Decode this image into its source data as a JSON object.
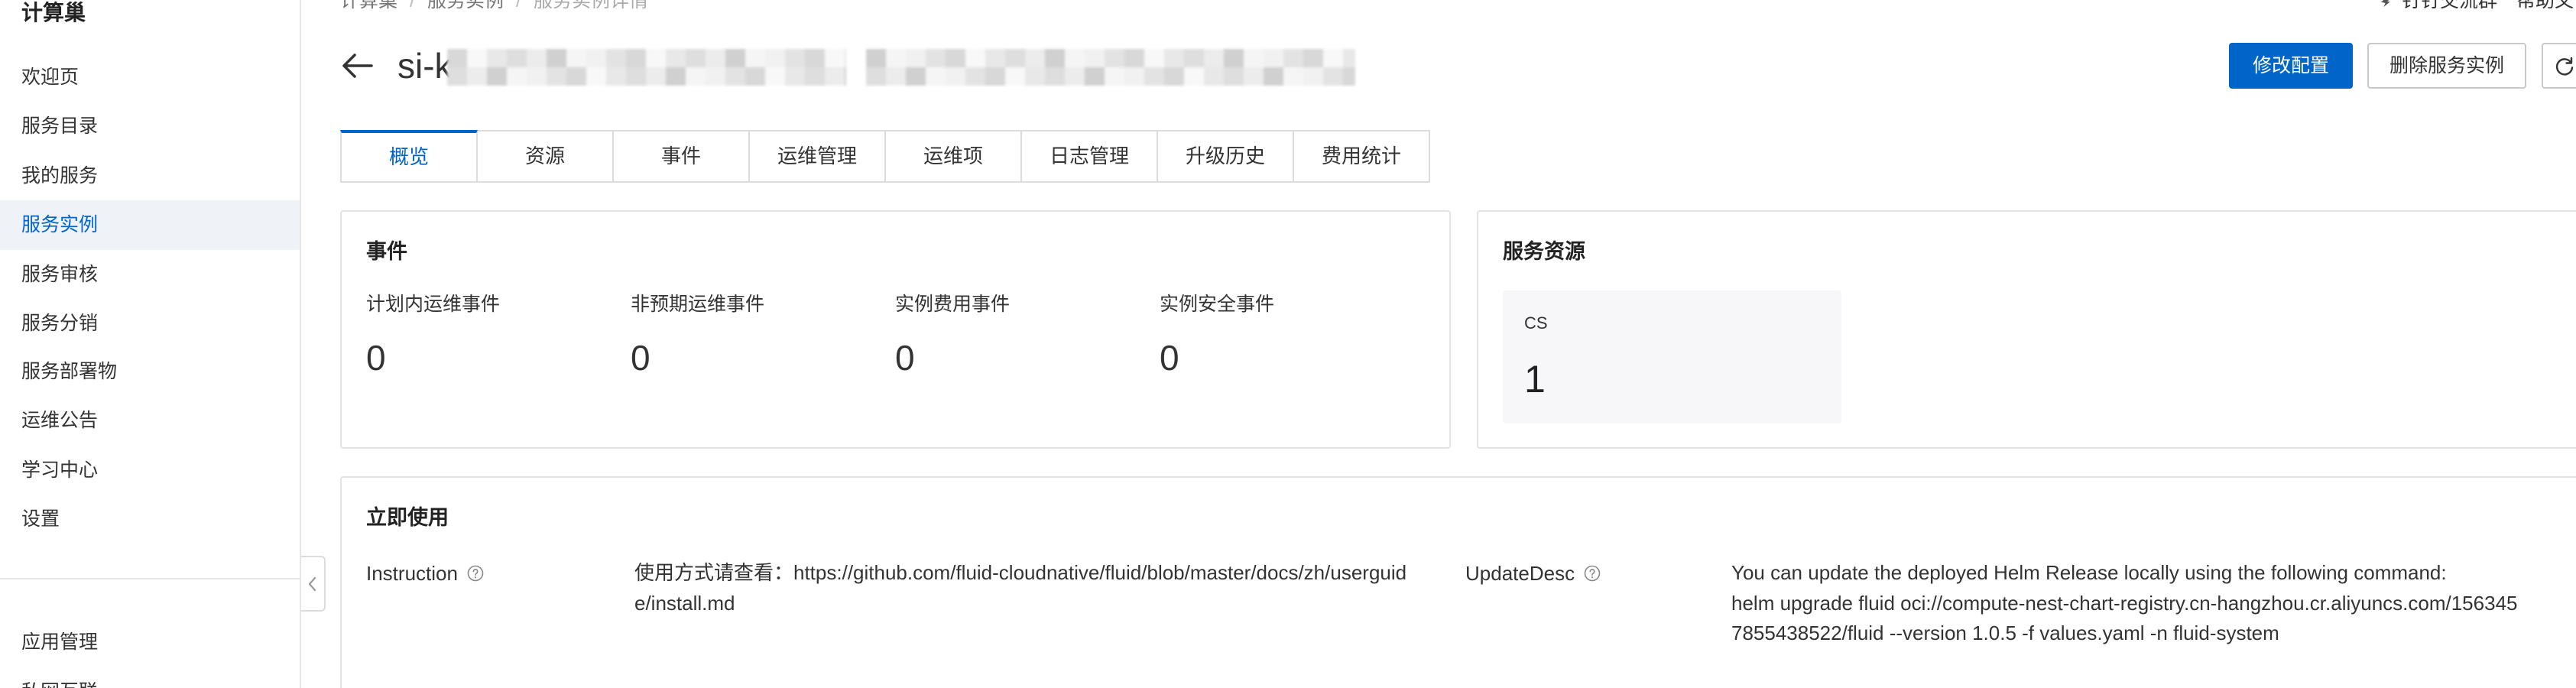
{
  "sidebar": {
    "title": "计算巢",
    "items": [
      {
        "label": "欢迎页"
      },
      {
        "label": "服务目录"
      },
      {
        "label": "我的服务"
      },
      {
        "label": "服务实例",
        "selected": true
      },
      {
        "label": "服务审核"
      },
      {
        "label": "服务分销"
      },
      {
        "label": "服务部署物"
      },
      {
        "label": "运维公告"
      },
      {
        "label": "学习中心"
      },
      {
        "label": "设置"
      }
    ],
    "bottom_items": [
      {
        "label": "应用管理"
      },
      {
        "label": "私网互联"
      }
    ]
  },
  "breadcrumb": {
    "items": [
      "计算巢",
      "服务实例",
      "服务实例详情"
    ],
    "separator": "/"
  },
  "header_links": {
    "dingtalk": "钉钉交流群",
    "help": "帮助文"
  },
  "instance": {
    "title": "si-k",
    "title_redacted": true
  },
  "actions": {
    "modify": "修改配置",
    "delete": "删除服务实例"
  },
  "tabs": [
    {
      "label": "概览",
      "selected": true
    },
    {
      "label": "资源"
    },
    {
      "label": "事件"
    },
    {
      "label": "运维管理"
    },
    {
      "label": "运维项"
    },
    {
      "label": "日志管理"
    },
    {
      "label": "升级历史"
    },
    {
      "label": "费用统计"
    }
  ],
  "events_card": {
    "title": "事件",
    "stats": [
      {
        "label": "计划内运维事件",
        "value": "0"
      },
      {
        "label": "非预期运维事件",
        "value": "0"
      },
      {
        "label": "实例费用事件",
        "value": "0"
      },
      {
        "label": "实例安全事件",
        "value": "0"
      }
    ]
  },
  "resources_card": {
    "title": "服务资源",
    "items": [
      {
        "label": "CS",
        "value": "1"
      }
    ]
  },
  "usage_card": {
    "title": "立即使用",
    "fields": [
      {
        "label": "Instruction",
        "value": "使用方式请查看：https://github.com/fluid-cloudnative/fluid/blob/master/docs/zh/userguide/install.md"
      },
      {
        "label": "UpdateDesc",
        "value": "You can update the deployed Helm Release locally using the following command:\nhelm upgrade fluid oci://compute-nest-chart-registry.cn-hangzhou.cr.aliyuncs.com/1563457855438522/fluid --version 1.0.5 -f values.yaml -n fluid-system"
      }
    ]
  },
  "icons": {
    "back": "arrow-left-icon",
    "refresh": "refresh-icon",
    "help": "question-circle-icon",
    "dingtalk": "dingtalk-icon",
    "sidebar_collapse": "chevron-left-icon"
  },
  "colors": {
    "primary": "#0064c8",
    "active_menu_bg": "#eff3f8",
    "text": "#333333",
    "border": "#e3e3e3",
    "muted": "#888888",
    "resource_tile_bg": "#f7f7f9"
  }
}
